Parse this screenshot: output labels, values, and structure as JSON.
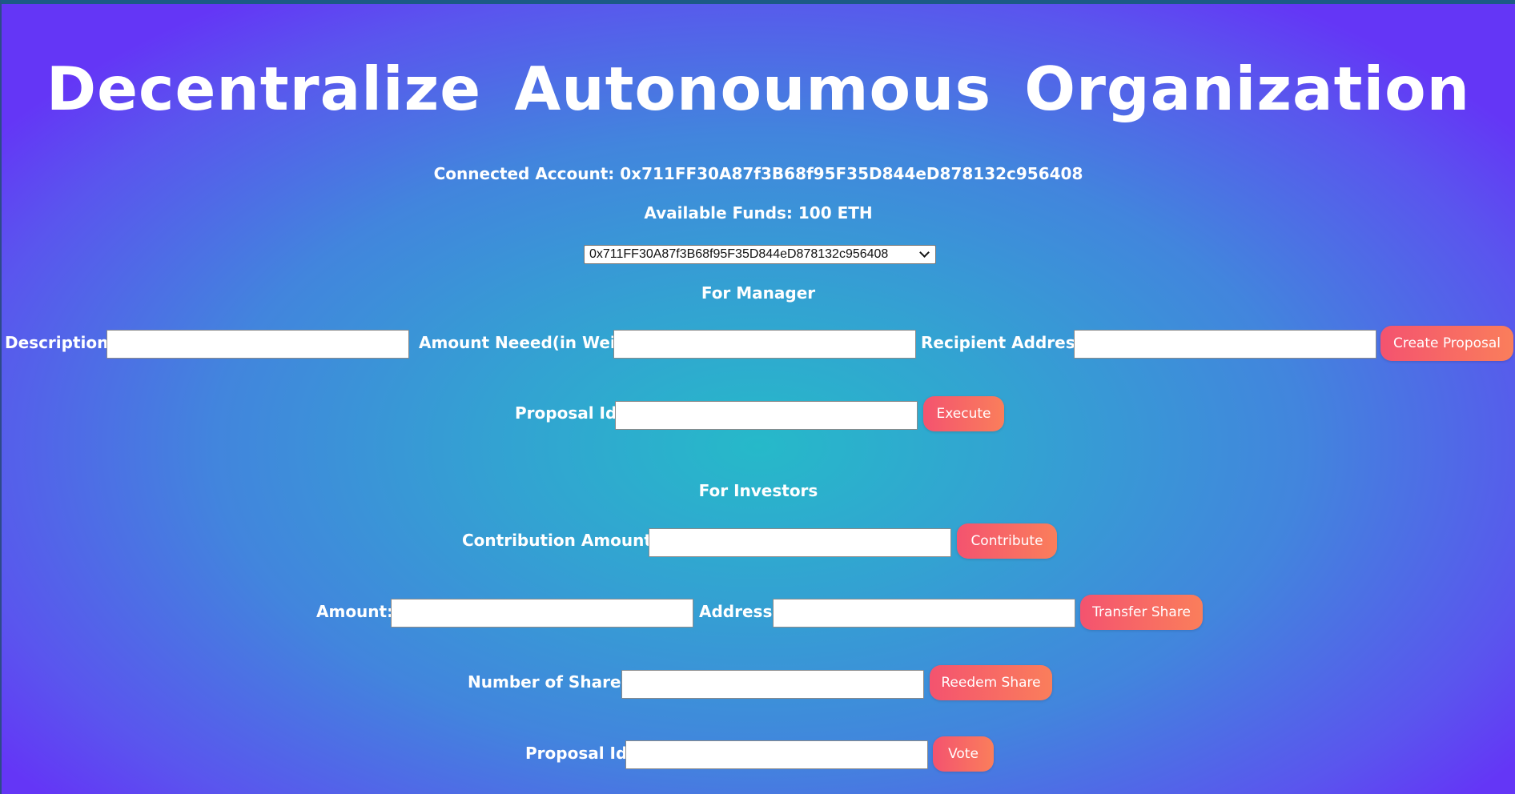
{
  "title": "Decentralize Autonoumous Organization",
  "account": {
    "connected_text": "Connected Account: 0x711FF30A87f3B68f95F35D844eD878132c956408",
    "funds_text": "Available Funds: 100 ETH",
    "selected_account": "0x711FF30A87f3B68f95F35D844eD878132c956408"
  },
  "manager": {
    "heading": "For Manager",
    "description_label": "Description:",
    "amount_label": "Amount Neeed(in Wei):",
    "recipient_label": "Recipient Address:",
    "create_button": "Create Proposal",
    "proposal_id_label": "Proposal Id:",
    "execute_button": "Execute"
  },
  "investors": {
    "heading": "For Investors",
    "contribution_label": "Contribution Amount:",
    "contribute_button": "Contribute",
    "amount_label": "Amount:",
    "address_label": "Address:",
    "transfer_button": "Transfer Share",
    "shares_label": "Number of Shares:",
    "redeem_button": "Reedem Share",
    "proposal_id_label": "Proposal Id:",
    "vote_button": "Vote"
  },
  "colors": {
    "button_start": "#f4536f",
    "button_end": "#fa7e5b",
    "bg_center": "#26b9c9",
    "bg_edge": "#6436f6"
  }
}
